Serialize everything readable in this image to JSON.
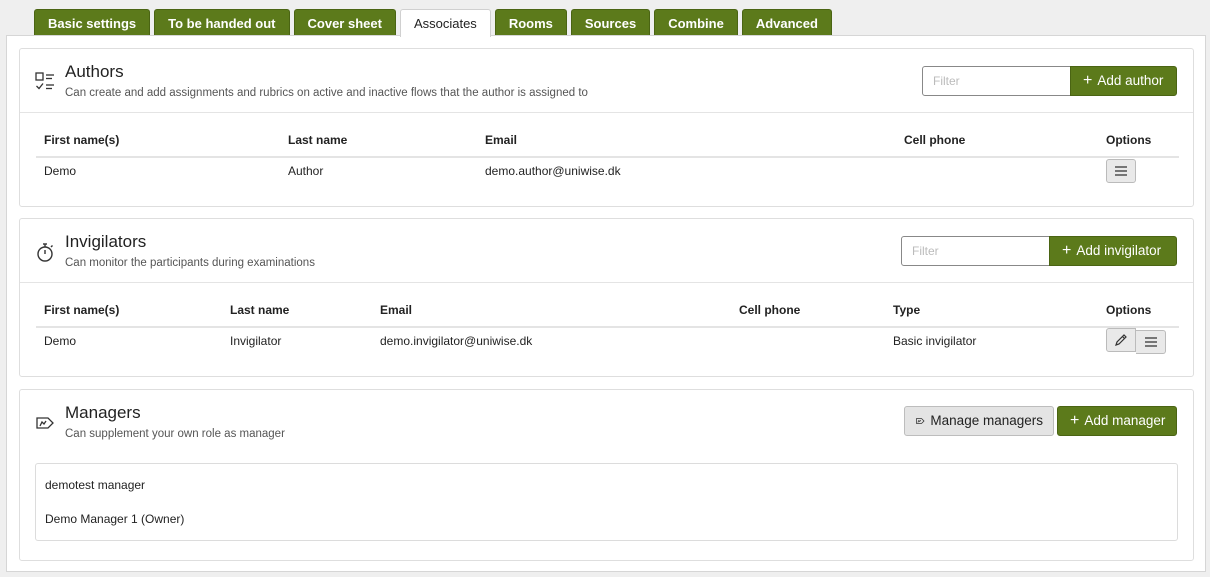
{
  "tabs": [
    {
      "label": "Basic settings",
      "active": false
    },
    {
      "label": "To be handed out",
      "active": false
    },
    {
      "label": "Cover sheet",
      "active": false
    },
    {
      "label": "Associates",
      "active": true
    },
    {
      "label": "Rooms",
      "active": false
    },
    {
      "label": "Sources",
      "active": false
    },
    {
      "label": "Combine",
      "active": false
    },
    {
      "label": "Advanced",
      "active": false
    }
  ],
  "authors": {
    "title": "Authors",
    "subtitle": "Can create and add assignments and rubrics on active and inactive flows that the author is assigned to",
    "filter_placeholder": "Filter",
    "add_label": "Add author",
    "columns": [
      "First name(s)",
      "Last name",
      "Email",
      "Cell phone",
      "Options"
    ],
    "rows": [
      {
        "first": "Demo",
        "last": "Author",
        "email": "demo.author@uniwise.dk",
        "phone": ""
      }
    ]
  },
  "invigilators": {
    "title": "Invigilators",
    "subtitle": "Can monitor the participants during examinations",
    "filter_placeholder": "Filter",
    "add_label": "Add invigilator",
    "columns": [
      "First name(s)",
      "Last name",
      "Email",
      "Cell phone",
      "Type",
      "Options"
    ],
    "rows": [
      {
        "first": "Demo",
        "last": "Invigilator",
        "email": "demo.invigilator@uniwise.dk",
        "phone": "",
        "type": "Basic invigilator"
      }
    ]
  },
  "managers": {
    "title": "Managers",
    "subtitle": "Can supplement your own role as manager",
    "manage_label": "Manage managers",
    "add_label": "Add manager",
    "items": [
      "demotest manager",
      "Demo Manager 1 (Owner)"
    ]
  },
  "icons": {
    "authors": "checklist-icon",
    "invigilators": "stopwatch-icon",
    "managers": "manager-tag-icon",
    "options": "hamburger-menu-icon",
    "edit": "pencil-icon"
  },
  "colors": {
    "accent": "#5c7a1b",
    "accent_border": "#4a6413"
  }
}
